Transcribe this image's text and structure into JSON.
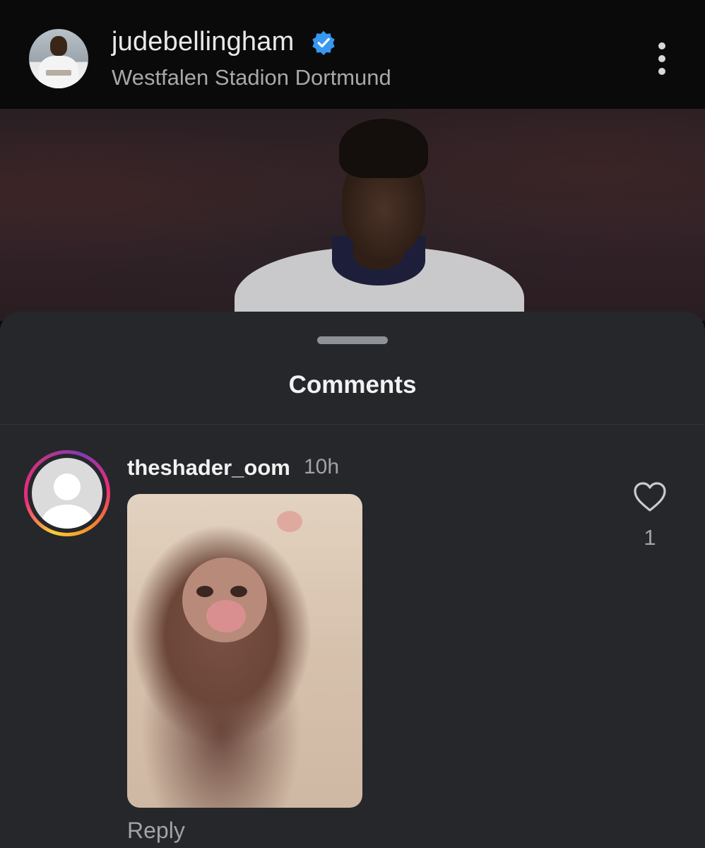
{
  "post": {
    "username": "judebellingham",
    "verified": true,
    "location": "Westfalen Stadion Dortmund",
    "menu_icon": "more-vertical-icon"
  },
  "sheet": {
    "title": "Comments"
  },
  "comments": [
    {
      "username": "theshader_oom",
      "time": "10h",
      "attachment": "gif",
      "like_count": "1",
      "reply_label": "Reply"
    }
  ],
  "colors": {
    "background": "#0b0b0d",
    "sheet": "#25272b",
    "verified": "#3897f0",
    "muted_text": "#a0a3a8"
  }
}
